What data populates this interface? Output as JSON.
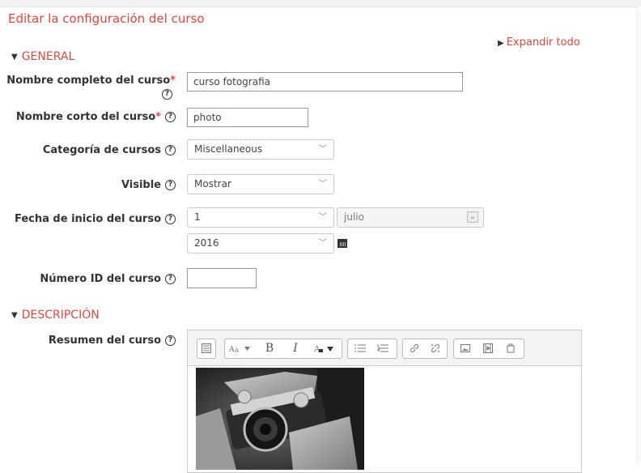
{
  "page": {
    "title": "Editar la configuración del curso",
    "expand_all": "Expandir todo"
  },
  "sections": {
    "general": "GENERAL",
    "description": "DESCRIPCIÓN"
  },
  "help_glyph": "?",
  "required_mark": "*",
  "fields": {
    "fullname": {
      "label": "Nombre completo del curso",
      "value": "curso fotografia"
    },
    "shortname": {
      "label": "Nombre corto del curso",
      "value": "photo"
    },
    "category": {
      "label": "Categoría de cursos",
      "value": "Miscellaneous"
    },
    "visible": {
      "label": "Visible",
      "value": "Mostrar"
    },
    "startdate": {
      "label": "Fecha de inicio del curso",
      "day": "1",
      "month": "julio",
      "year": "2016"
    },
    "idnumber": {
      "label": "Número ID del curso",
      "value": ""
    },
    "summary": {
      "label": "Resumen del curso"
    }
  },
  "toolbar_icons": [
    "toolbar-toggle-icon",
    "font-style-icon",
    "bold-icon",
    "italic-icon",
    "font-color-icon",
    "unordered-list-icon",
    "ordered-list-icon",
    "link-icon",
    "unlink-icon",
    "image-icon",
    "media-icon",
    "manage-files-icon"
  ],
  "toolbar_glyphs": {
    "bold": "B",
    "italic": "I"
  },
  "colors": {
    "accent": "#e0463f",
    "text": "#333333"
  }
}
